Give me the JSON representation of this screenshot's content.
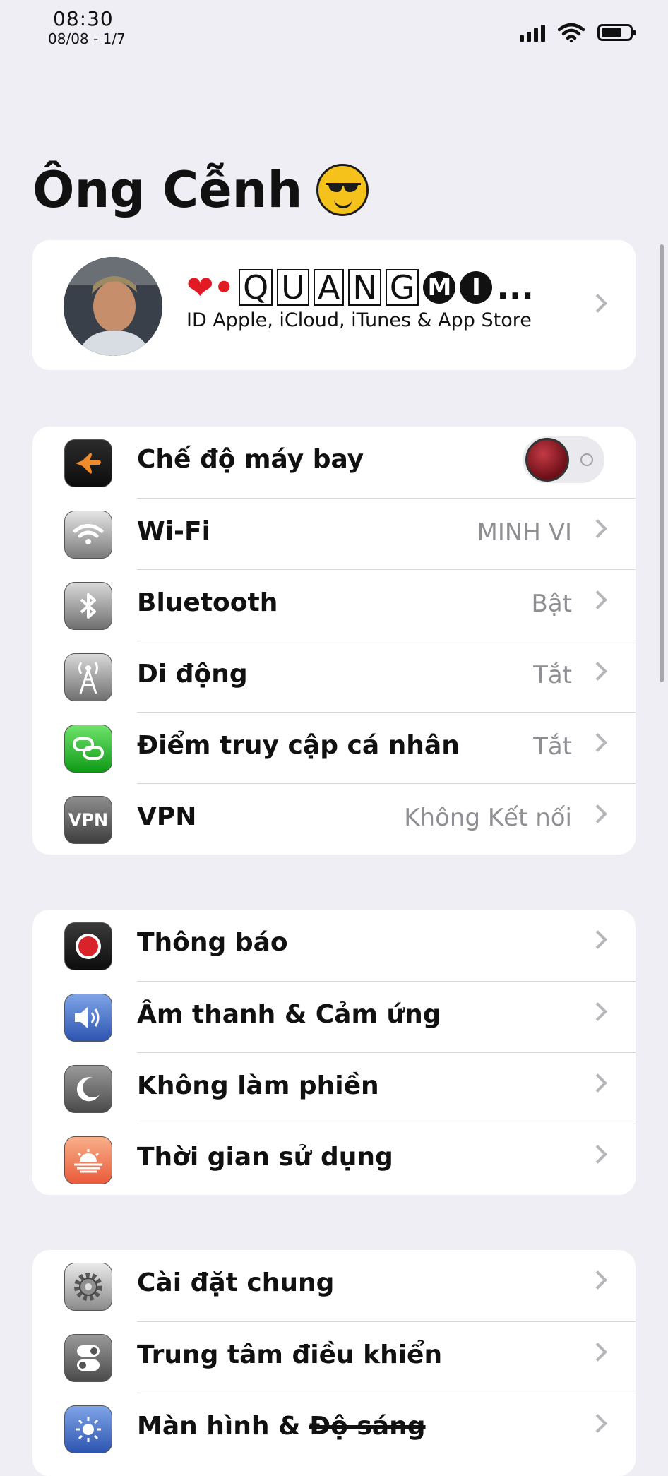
{
  "status_bar": {
    "time": "08:30",
    "date": "08/08 - 1/7",
    "icons": [
      "signal-icon",
      "wifi-icon",
      "battery-icon"
    ]
  },
  "title": "Ông Cễnh",
  "profile": {
    "name_prefix": "❤•",
    "name_boxed": [
      "Q",
      "U",
      "A",
      "N",
      "G"
    ],
    "name_circled": [
      "M",
      "I"
    ],
    "name_suffix": "...",
    "subtitle": "ID Apple, iCloud, iTunes & App Store"
  },
  "group1": [
    {
      "label": "Chế độ máy bay",
      "icon": "airplane-icon",
      "toggle": true,
      "toggle_on": false
    },
    {
      "label": "Wi-Fi",
      "value": "MINH VI",
      "icon": "wifi-icon"
    },
    {
      "label": "Bluetooth",
      "value": "Bật",
      "icon": "bluetooth-icon"
    },
    {
      "label": "Di động",
      "value": "Tắt",
      "icon": "cellular-icon"
    },
    {
      "label": "Điểm truy cập cá nhân",
      "value": "Tắt",
      "icon": "hotspot-icon"
    },
    {
      "label": "VPN",
      "value": "Không Kết nối",
      "icon": "vpn-icon",
      "icon_text": "VPN"
    }
  ],
  "group2": [
    {
      "label": "Thông báo",
      "icon": "notifications-icon"
    },
    {
      "label": "Âm thanh & Cảm ứng",
      "icon": "sound-icon"
    },
    {
      "label": "Không làm phiền",
      "icon": "moon-icon"
    },
    {
      "label": "Thời gian sử dụng",
      "icon": "screen-time-icon"
    }
  ],
  "group3": [
    {
      "label": "Cài đặt chung",
      "icon": "gear-icon"
    },
    {
      "label": "Trung tâm điều khiển",
      "icon": "control-center-icon"
    },
    {
      "label_main": "Màn hình & ",
      "label_struck": "Độ sáng",
      "icon": "brightness-icon"
    }
  ],
  "colors": {
    "background": "#efeef4",
    "card": "#ffffff",
    "value_text": "#8e8e93",
    "chevron": "#b5b5ba"
  }
}
